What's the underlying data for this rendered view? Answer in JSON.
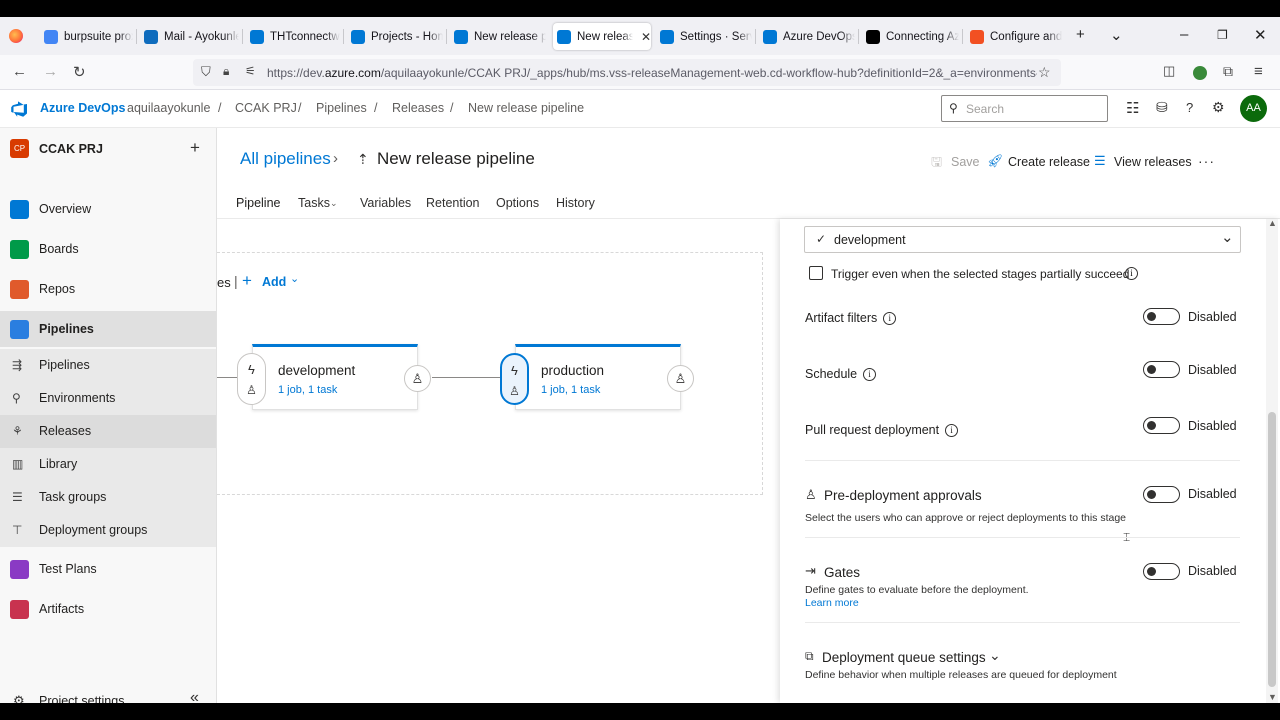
{
  "browser": {
    "tabs": [
      {
        "title": "burpsuite proxy",
        "color": "#4285f4"
      },
      {
        "title": "Mail - Ayokunle",
        "color": "#0f6cbd"
      },
      {
        "title": "THTconnectwit",
        "color": "#0078d4"
      },
      {
        "title": "Projects - Hom",
        "color": "#0078d4"
      },
      {
        "title": "New release pi",
        "color": "#0078d4"
      },
      {
        "title": "New release",
        "color": "#0078d4"
      },
      {
        "title": "Settings · Servi",
        "color": "#0078d4"
      },
      {
        "title": "Azure DevOps",
        "color": "#0078d4"
      },
      {
        "title": "Connecting Azu",
        "color": "#000000"
      },
      {
        "title": "Configure and",
        "color": "#f25022"
      }
    ],
    "new_tab": "+",
    "tab_list": "⌄",
    "url_prefix": "https://dev.",
    "url_host": "azure.com",
    "url_rest": "/aquilaayokunle/CCAK PRJ/_apps/hub/ms.vss-releaseManagement-web.cd-workflow-hub?definitionId=2&_a=environments-edito"
  },
  "header": {
    "brand": "Azure DevOps",
    "breadcrumb": [
      "aquilaayokunle",
      "CCAK PRJ",
      "Pipelines",
      "Releases",
      "New release pipeline"
    ],
    "search_placeholder": "Search",
    "avatar_initials": "AA"
  },
  "sidebar": {
    "project_badge": "CP",
    "project_name": "CCAK PRJ",
    "add": "+",
    "items": [
      {
        "label": "Overview",
        "color": "#0078d4"
      },
      {
        "label": "Boards",
        "color": "#009a49"
      },
      {
        "label": "Repos",
        "color": "#e05a2b"
      },
      {
        "label": "Pipelines",
        "color": "#2a7ee0"
      }
    ],
    "sub_items": [
      "Pipelines",
      "Environments",
      "Releases",
      "Library",
      "Task groups",
      "Deployment groups"
    ],
    "more_items": [
      {
        "label": "Test Plans",
        "color": "#8a3ac4"
      },
      {
        "label": "Artifacts",
        "color": "#c8334f"
      }
    ],
    "settings_label": "Project settings",
    "collapse": "«"
  },
  "page": {
    "parent": "All pipelines",
    "title": "New release pipeline",
    "save": "Save",
    "create_release": "Create release",
    "view_releases": "View releases",
    "more": "···",
    "tabs": [
      "Pipeline",
      "Tasks",
      "Variables",
      "Retention",
      "Options",
      "History"
    ]
  },
  "canvas": {
    "stages_fragment": "es",
    "add_label": "Add",
    "stages": [
      {
        "name": "development",
        "summary": "1 job, 1 task"
      },
      {
        "name": "production",
        "summary": "1 job, 1 task"
      }
    ]
  },
  "panel": {
    "selected_stage": "development",
    "partial_trigger": "Trigger even when the selected stages partially succeed",
    "rows": [
      {
        "label": "Artifact filters",
        "state": "Disabled"
      },
      {
        "label": "Schedule",
        "state": "Disabled"
      },
      {
        "label": "Pull request deployment",
        "state": "Disabled"
      }
    ],
    "approvals": {
      "title": "Pre-deployment approvals",
      "state": "Disabled",
      "desc": "Select the users who can approve or reject deployments to this stage"
    },
    "gates": {
      "title": "Gates",
      "state": "Disabled",
      "desc": "Define gates to evaluate before the deployment.",
      "link": "Learn more"
    },
    "queue": {
      "title": "Deployment queue settings",
      "desc": "Define behavior when multiple releases are queued for deployment"
    }
  }
}
